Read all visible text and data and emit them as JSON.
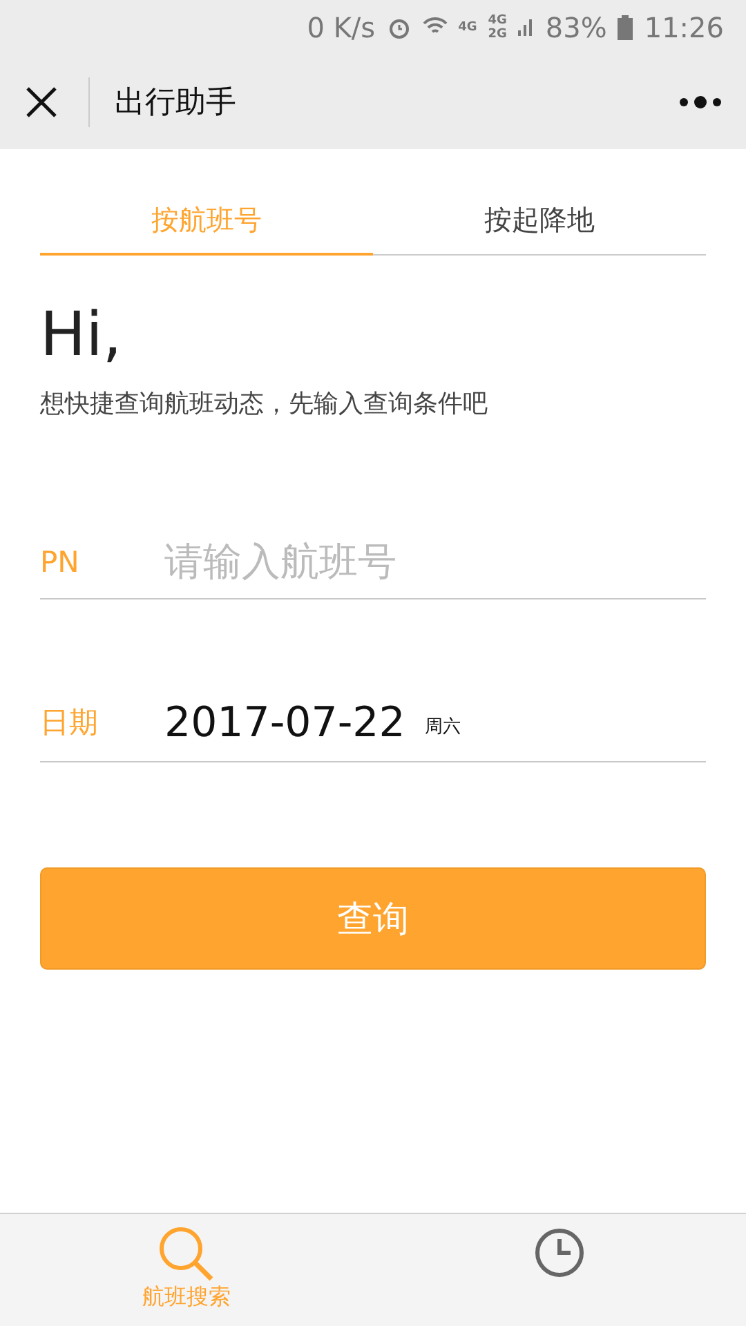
{
  "status_bar": {
    "speed": "0 K/s",
    "network": [
      "4G",
      "4G",
      "2G"
    ],
    "battery": "83%",
    "time": "11:26"
  },
  "nav": {
    "title": "出行助手"
  },
  "tabs": [
    {
      "label": "按航班号",
      "selected": true
    },
    {
      "label": "按起降地",
      "selected": false
    }
  ],
  "greeting": "Hi,",
  "subtitle": "想快捷查询航班动态，先输入查询条件吧",
  "fields": [
    {
      "kind": "input",
      "label": "PN",
      "placeholder": "请输入航班号"
    },
    {
      "kind": "date",
      "label": "日期",
      "value": "2017-07-22",
      "weekday": "周六"
    }
  ],
  "submit": "查询",
  "tab_bar": [
    {
      "kind": "search",
      "label": "航班搜索",
      "selected": true
    },
    {
      "kind": "clock",
      "selected": false
    }
  ]
}
